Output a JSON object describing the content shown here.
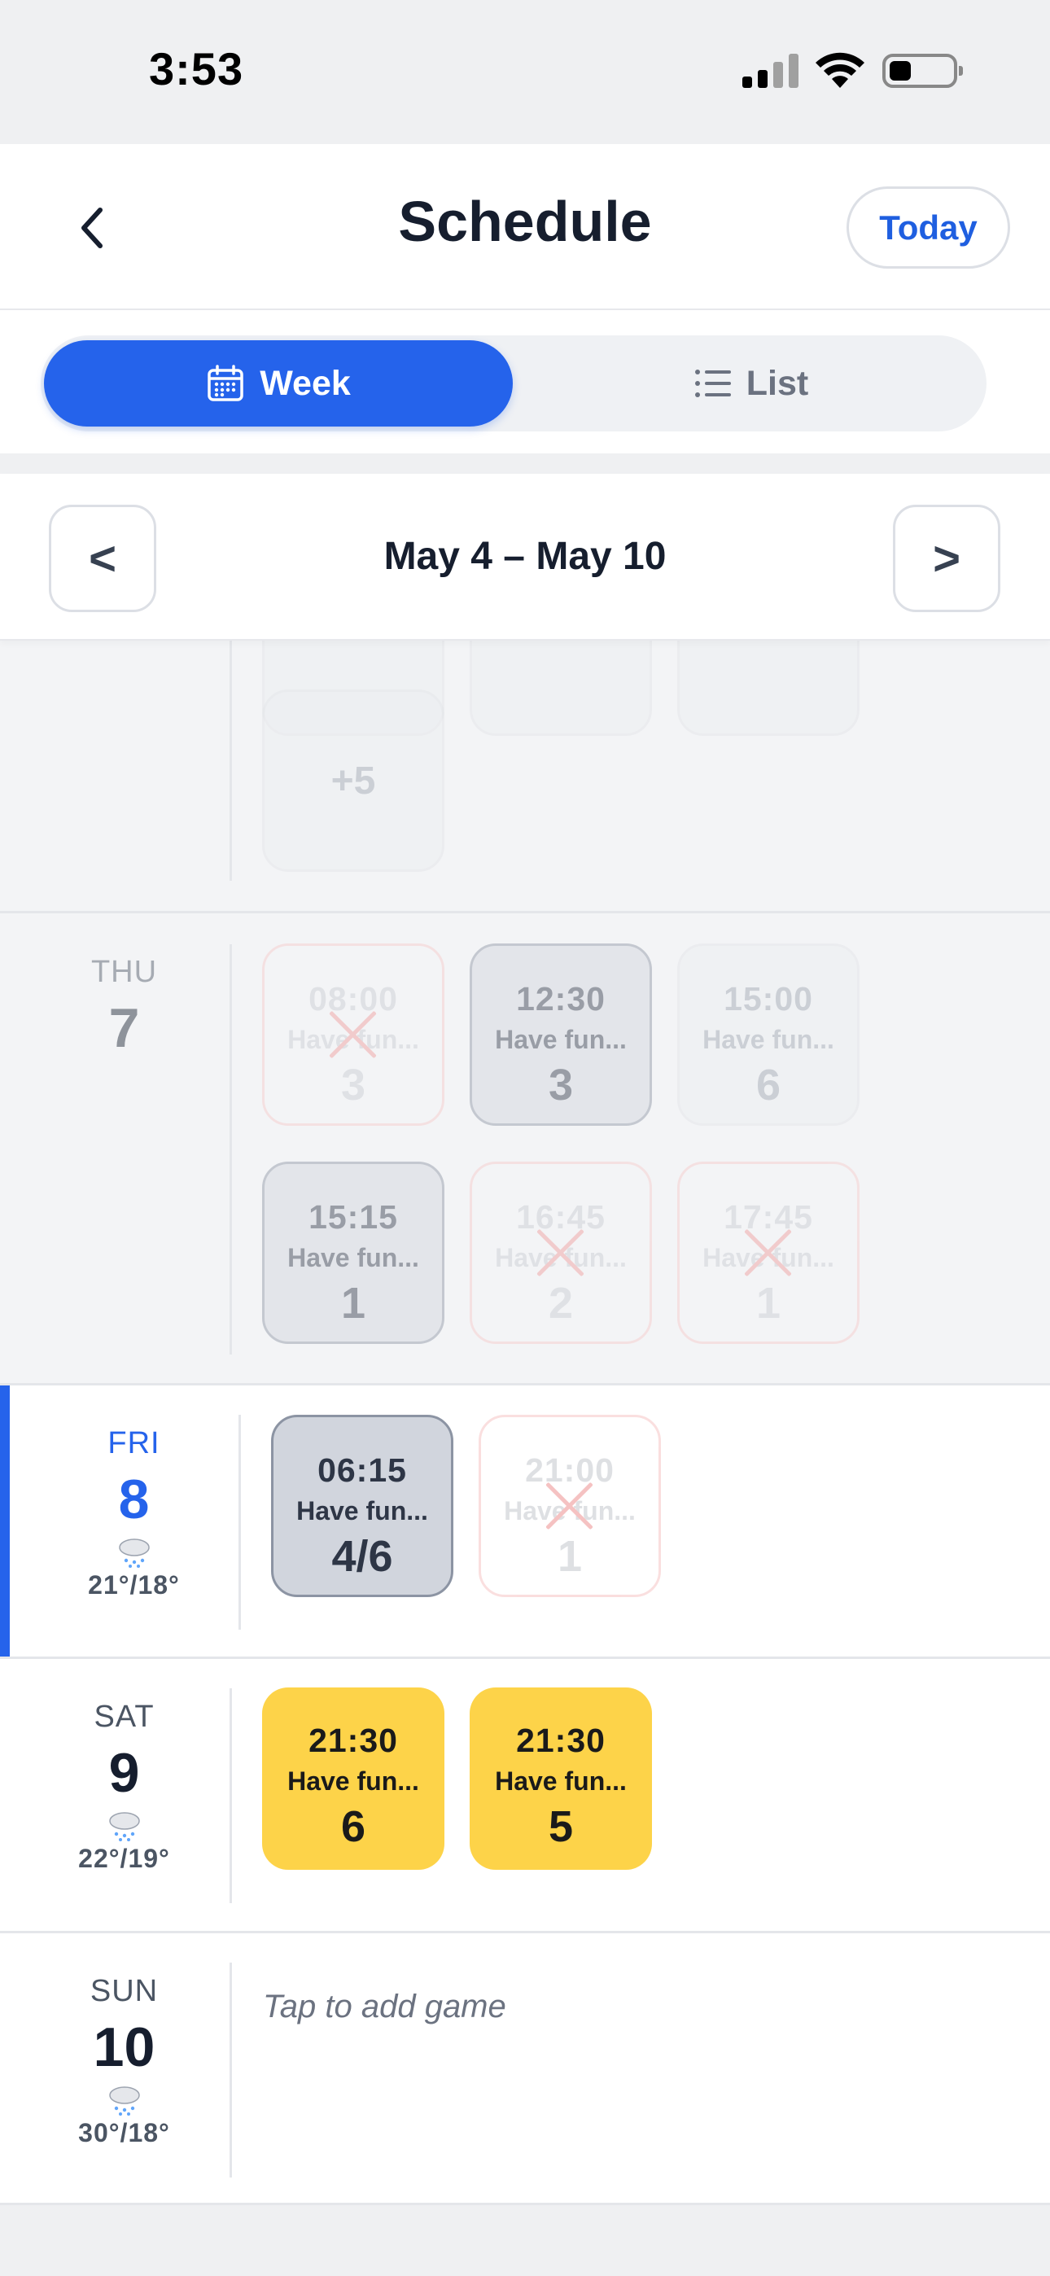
{
  "status_bar": {
    "time": "3:53"
  },
  "header": {
    "title": "Schedule",
    "today_label": "Today"
  },
  "view_toggle": {
    "week_label": "Week",
    "list_label": "List",
    "selected": "Week"
  },
  "week_nav": {
    "prev_label": "<",
    "next_label": ">",
    "range": "May 4 – May 10"
  },
  "colors": {
    "accent": "#2563eb",
    "game_open": "#fdd349",
    "cancelled_x": "#f09a9a"
  },
  "days": {
    "wed": {
      "more_label": "+5"
    },
    "thu": {
      "name": "THU",
      "num": "7",
      "slots": [
        {
          "time": "08:00",
          "title": "Have fun...",
          "count": "3",
          "state": "cancelled"
        },
        {
          "time": "12:30",
          "title": "Have fun...",
          "count": "3",
          "state": "joined"
        },
        {
          "time": "15:00",
          "title": "Have fun...",
          "count": "6",
          "state": "past"
        },
        {
          "time": "15:15",
          "title": "Have fun...",
          "count": "1",
          "state": "joined"
        },
        {
          "time": "16:45",
          "title": "Have fun...",
          "count": "2",
          "state": "cancelled"
        },
        {
          "time": "17:45",
          "title": "Have fun...",
          "count": "1",
          "state": "cancelled"
        }
      ]
    },
    "fri": {
      "name": "FRI",
      "num": "8",
      "weather_icon": "rain-snow-cloud-icon",
      "temps": "21°/18°",
      "slots": [
        {
          "time": "06:15",
          "title": "Have fun...",
          "count": "4/6",
          "state": "joined"
        },
        {
          "time": "21:00",
          "title": "Have fun...",
          "count": "1",
          "state": "cancelled"
        }
      ]
    },
    "sat": {
      "name": "SAT",
      "num": "9",
      "weather_icon": "rain-snow-cloud-icon",
      "temps": "22°/19°",
      "slots": [
        {
          "time": "21:30",
          "title": "Have fun...",
          "count": "6",
          "state": "open"
        },
        {
          "time": "21:30",
          "title": "Have fun...",
          "count": "5",
          "state": "open"
        }
      ]
    },
    "sun": {
      "name": "SUN",
      "num": "10",
      "weather_icon": "rain-snow-cloud-icon",
      "temps": "30°/18°",
      "add_hint": "Tap to add game"
    }
  }
}
